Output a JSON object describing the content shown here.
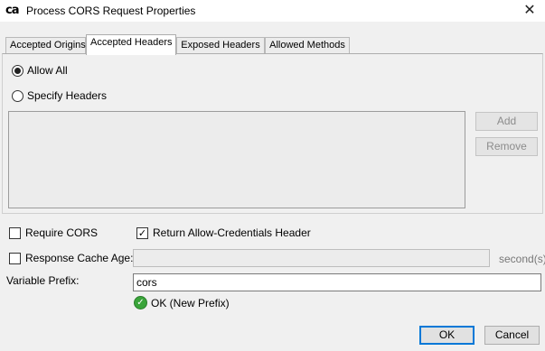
{
  "window": {
    "logo": "ca",
    "title": "Process CORS Request Properties",
    "close_glyph": "✕"
  },
  "tabs": [
    {
      "label": "Accepted Origins",
      "active": false
    },
    {
      "label": "Accepted Headers",
      "active": true
    },
    {
      "label": "Exposed Headers",
      "active": false
    },
    {
      "label": "Allowed Methods",
      "active": false
    }
  ],
  "headers": {
    "allow_all_label": "Allow All",
    "allow_all_selected": true,
    "specify_label": "Specify Headers",
    "specify_selected": false,
    "list_items": [],
    "add_label": "Add",
    "remove_label": "Remove"
  },
  "options": {
    "require_cors_label": "Require CORS",
    "require_cors_checked": false,
    "return_credentials_label": "Return Allow-Credentials Header",
    "return_credentials_checked": true,
    "cache_age_label": "Response Cache Age:",
    "cache_age_checked": false,
    "cache_age_value": "",
    "cache_age_unit": "second(s)",
    "check_glyph": "✓"
  },
  "prefix": {
    "label": "Variable Prefix:",
    "value": "cors",
    "status_icon": "check-circle-icon",
    "status_glyph": "✓",
    "status_text": "OK (New Prefix)"
  },
  "footer": {
    "ok_label": "OK",
    "cancel_label": "Cancel"
  },
  "colors": {
    "ok_status": "#3aa43a",
    "primary_button_border": "#0078d7"
  }
}
